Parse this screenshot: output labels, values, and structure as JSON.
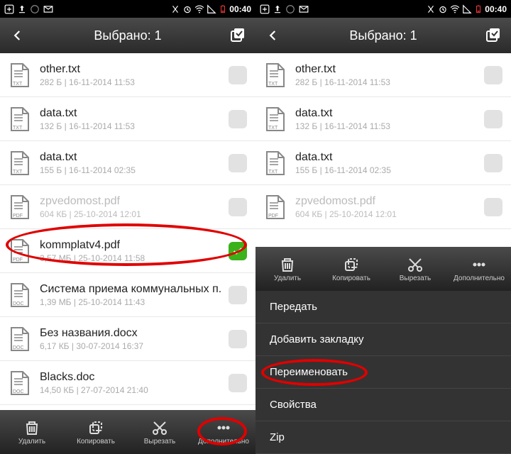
{
  "status": {
    "time": "00:40"
  },
  "appbar": {
    "title": "Выбрано: 1"
  },
  "toolbar": {
    "delete": "Удалить",
    "copy": "Копировать",
    "cut": "Вырезать",
    "more": "Дополнительно"
  },
  "menu": {
    "send": "Передать",
    "bookmark": "Добавить закладку",
    "rename": "Переименовать",
    "properties": "Свойства",
    "zip": "Zip"
  },
  "left_files": [
    {
      "name": "other.txt",
      "meta": "282 Б | 16-11-2014 11:53",
      "type": "txt",
      "checked": false
    },
    {
      "name": "data.txt",
      "meta": "132 Б | 16-11-2014 11:53",
      "type": "txt",
      "checked": false
    },
    {
      "name": "data.txt",
      "meta": "155 Б | 16-11-2014 02:35",
      "type": "txt",
      "checked": false
    },
    {
      "name": "zpvedomost.pdf",
      "meta": "604 КБ | 25-10-2014 12:01",
      "type": "pdf",
      "checked": false,
      "faded": true
    },
    {
      "name": "kommplatv4.pdf",
      "meta": "3,57 МБ | 25-10-2014 11:58",
      "type": "pdf",
      "checked": true
    },
    {
      "name": "Система приема коммунальных п.",
      "meta": "1,39 МБ | 25-10-2014 11:43",
      "type": "doc",
      "checked": false
    },
    {
      "name": "Без названия.docx",
      "meta": "6,17 КБ | 30-07-2014 16:37",
      "type": "doc",
      "checked": false
    },
    {
      "name": "Blacks.doc",
      "meta": "14,50 КБ | 27-07-2014 21:40",
      "type": "doc",
      "checked": false
    }
  ],
  "right_files": [
    {
      "name": "other.txt",
      "meta": "282 Б | 16-11-2014 11:53",
      "type": "txt",
      "checked": false
    },
    {
      "name": "data.txt",
      "meta": "132 Б | 16-11-2014 11:53",
      "type": "txt",
      "checked": false
    },
    {
      "name": "data.txt",
      "meta": "155 Б | 16-11-2014 02:35",
      "type": "txt",
      "checked": false
    },
    {
      "name": "zpvedomost.pdf",
      "meta": "604 КБ | 25-10-2014 12:01",
      "type": "pdf",
      "checked": false,
      "faded": true
    }
  ]
}
